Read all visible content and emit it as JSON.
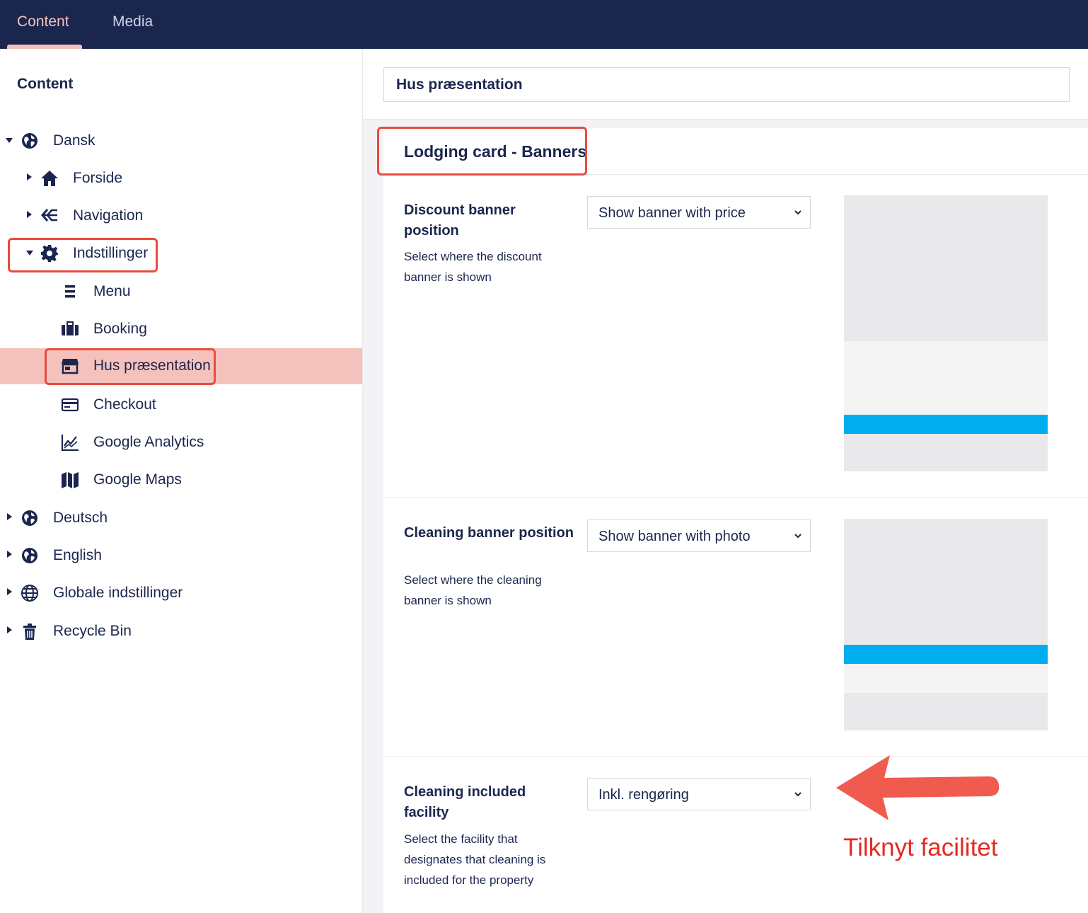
{
  "topnav": {
    "tabs": [
      {
        "label": "Content"
      },
      {
        "label": "Media"
      }
    ]
  },
  "sidebar": {
    "title": "Content",
    "tree": [
      {
        "label": "Dansk",
        "icon": "globe-icon"
      },
      {
        "label": "Forside",
        "icon": "home-icon"
      },
      {
        "label": "Navigation",
        "icon": "navigation-icon"
      },
      {
        "label": "Indstillinger",
        "icon": "gear-icon"
      },
      {
        "label": "Menu",
        "icon": "menu-icon"
      },
      {
        "label": "Booking",
        "icon": "suitcase-icon"
      },
      {
        "label": "Hus præsentation",
        "icon": "store-icon"
      },
      {
        "label": "Checkout",
        "icon": "credit-card-icon"
      },
      {
        "label": "Google Analytics",
        "icon": "chart-icon"
      },
      {
        "label": "Google Maps",
        "icon": "map-icon"
      },
      {
        "label": "Deutsch",
        "icon": "globe-icon"
      },
      {
        "label": "English",
        "icon": "globe-icon"
      },
      {
        "label": "Globale indstillinger",
        "icon": "world-grid-icon"
      },
      {
        "label": "Recycle Bin",
        "icon": "trash-icon"
      }
    ]
  },
  "editor": {
    "name": "Hus præsentation",
    "group_title": "Lodging card - Banners",
    "properties": [
      {
        "label": "Discount banner position",
        "description": "Select where the discount banner is shown",
        "value": "Show banner with price"
      },
      {
        "label": "Cleaning banner position",
        "description": "Select where the cleaning banner is shown",
        "value": "Show banner with photo"
      },
      {
        "label": "Cleaning included facility",
        "description": "Select the facility that designates that cleaning is included for the property",
        "value": "Inkl. rengøring"
      }
    ]
  },
  "annotation": {
    "text": "Tilknyt facilitet",
    "color": "#e32b22"
  },
  "colors": {
    "topbar": "#1b264f",
    "accent": "#f5c1bc",
    "highlight": "#e94b3c",
    "preview_bar": "#00aeef"
  }
}
